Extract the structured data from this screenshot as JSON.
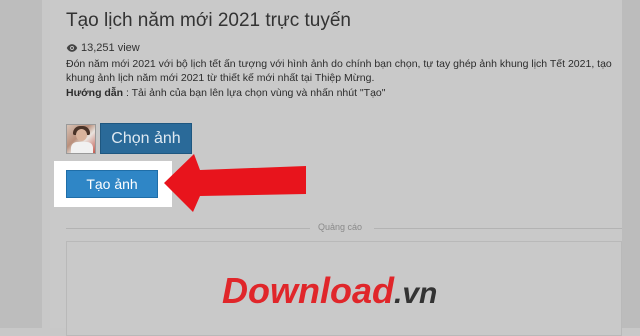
{
  "page": {
    "title": "Tạo lịch năm mới 2021 trực tuyến",
    "views": "13,251 view",
    "description": "Đón năm mới 2021 với bộ lịch tết ấn tượng với hình ảnh do chính bạn chọn, tự tay ghép ảnh khung lịch Tết 2021, tạo khung ảnh lịch năm mới 2021 từ thiết kế mới nhất tại Thiệp Mừng.",
    "guide_label": "Hướng dẫn",
    "guide_text": ": Tải ảnh của bạn lên lựa chọn vùng và nhấn nhút \"Tạo\""
  },
  "actions": {
    "choose_label": "Chọn ảnh",
    "create_label": "Tạo ảnh"
  },
  "ad": {
    "label": "Quảng cáo"
  },
  "watermark": {
    "brand": "Download",
    "tld": ".vn"
  },
  "colors": {
    "choose_button": "#2a6a99",
    "create_button": "#2f86c6",
    "arrow": "#e8141c",
    "watermark_red": "#e0262a"
  },
  "icons": {
    "views": "eye-icon",
    "annotation": "red-arrow-icon"
  }
}
